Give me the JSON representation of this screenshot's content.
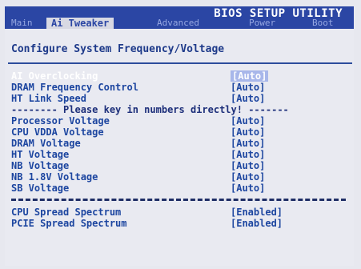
{
  "header": {
    "title": "BIOS SETUP UTILITY"
  },
  "menu": {
    "tabs": [
      {
        "label": "Main"
      },
      {
        "label": "Ai Tweaker"
      },
      {
        "label": "Advanced"
      },
      {
        "label": "Power"
      },
      {
        "label": "Boot"
      }
    ],
    "active_index": 1
  },
  "panel": {
    "title": "Configure System Frequency/Voltage",
    "items": [
      {
        "label": "AI Overclocking",
        "value": "[Auto]",
        "highlighted": true
      },
      {
        "label": "DRAM Frequency Control",
        "value": "[Auto]"
      },
      {
        "label": "HT Link Speed",
        "value": "[Auto]"
      }
    ],
    "notice": "-------- Please key in numbers directly! -------",
    "voltages": [
      {
        "label": "Processor Voltage",
        "value": "[Auto]"
      },
      {
        "label": "CPU VDDA Voltage",
        "value": "[Auto]"
      },
      {
        "label": "DRAM Voltage",
        "value": "[Auto]"
      },
      {
        "label": "HT Voltage",
        "value": "[Auto]"
      },
      {
        "label": "NB Voltage",
        "value": "[Auto]"
      },
      {
        "label": "NB 1.8V Voltage",
        "value": "[Auto]"
      },
      {
        "label": "SB Voltage",
        "value": "[Auto]"
      }
    ],
    "spread": [
      {
        "label": "CPU Spread Spectrum",
        "value": "[Enabled]"
      },
      {
        "label": "PCIE Spread Spectrum",
        "value": "[Enabled]"
      }
    ]
  },
  "colors": {
    "header_bg": "#2b46a4",
    "panel_bg": "#e9eaf1",
    "text_blue": "#1d46a0",
    "highlight_text": "#ffffff"
  }
}
